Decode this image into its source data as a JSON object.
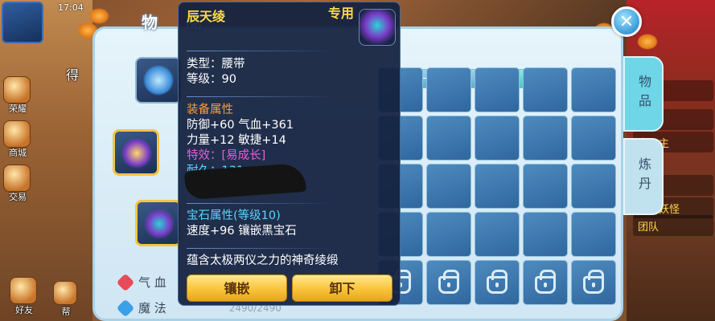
{
  "hud": {
    "time": "17:04",
    "left_labels": [
      "荣耀",
      "商城",
      "交易",
      "好友",
      "帮"
    ],
    "right_list": [
      "队伍",
      "福扇",
      "南公主",
      "水",
      "来的妖怪",
      "团队"
    ],
    "partial_label": "得"
  },
  "panel": {
    "title": "物 品",
    "close_icon": "close-icon",
    "side_tabs": [
      "物品",
      "炼丹"
    ],
    "bag_tabs": [
      "一",
      "二",
      "三"
    ],
    "active_bag_tab": 2,
    "attributes": [
      {
        "label": "气 血",
        "value": "",
        "icon_color": "#e84a5a"
      },
      {
        "label": "魔 法",
        "value": "2490/2490",
        "icon_color": "#3aa0e8"
      }
    ]
  },
  "tooltip": {
    "name": "辰天绫",
    "tag": "专用",
    "type_line": "类型：腰带",
    "level_line": "等级：90",
    "equip_attr_title": "装备属性",
    "attr_line1": "防御+60 气血+361",
    "attr_line2": "力量+12 敏捷+14",
    "effect_label": "特效：",
    "effect_value": "[易成长]",
    "durability_line": "耐久：131",
    "gem_title": "宝石属性(等级10)",
    "gem_line": "速度+96 镶嵌黑宝石",
    "description": "蕴含太极两仪之力的神奇绫缎",
    "inlay_button": "镶嵌",
    "unequip_button": "卸下"
  },
  "colors": {
    "item_name": "#ffd84a",
    "section_title": "#ff9c3a",
    "effect": "#e060e0",
    "gem": "#5ad4ff",
    "panel_bg": "#d8ecf6",
    "cell": "#3f7bb2",
    "active_tab": "#6fd6e8"
  }
}
